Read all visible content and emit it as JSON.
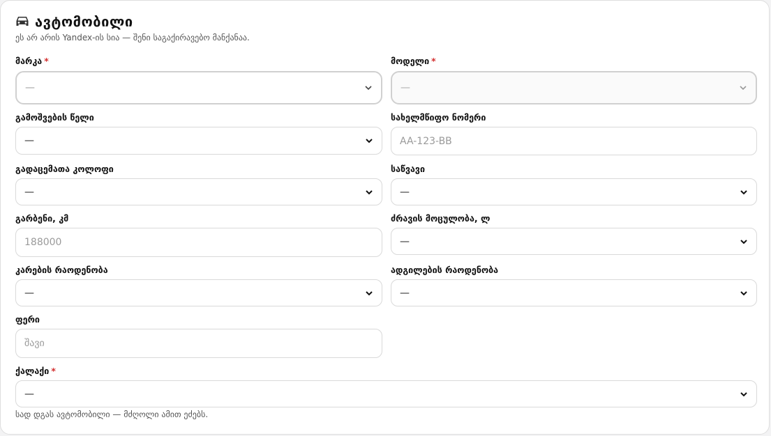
{
  "section": {
    "title": "ავტომობილი",
    "subtitle": "ეს არ არის Yandex-ის სია — შენი საგაქირავებო მანქანაა."
  },
  "fields": {
    "make": {
      "label": "მარკა",
      "required_mark": "*",
      "value": "—"
    },
    "model": {
      "label": "მოდელი",
      "required_mark": "*",
      "value": "—"
    },
    "year": {
      "label": "გამოშვების წელი",
      "value": "—"
    },
    "plate": {
      "label": "სახელმწიფო ნომერი",
      "placeholder": "AA-123-BB"
    },
    "transmission": {
      "label": "გადაცემათა კოლოფი",
      "value": "—"
    },
    "fuel": {
      "label": "საწვავი",
      "value": "—"
    },
    "mileage": {
      "label": "გარბენი, კმ",
      "placeholder": "188000"
    },
    "engine": {
      "label": "ძრავის მოცულობა, ლ",
      "value": "—"
    },
    "doors": {
      "label": "კარების რაოდენობა",
      "value": "—"
    },
    "seats": {
      "label": "ადგილების რაოდენობა",
      "value": "—"
    },
    "color": {
      "label": "ფერი",
      "placeholder": "შავი"
    },
    "city": {
      "label": "ქალაქი",
      "required_mark": "*",
      "value": "—",
      "hint": "სად დგას ავტომობილი — მძღოლი ამით ეძებს."
    }
  },
  "colors": {
    "required": "#d32f2f",
    "border": "#d9d9d9"
  },
  "icons": {
    "section": "car-icon",
    "select": "chevron-down-icon"
  }
}
